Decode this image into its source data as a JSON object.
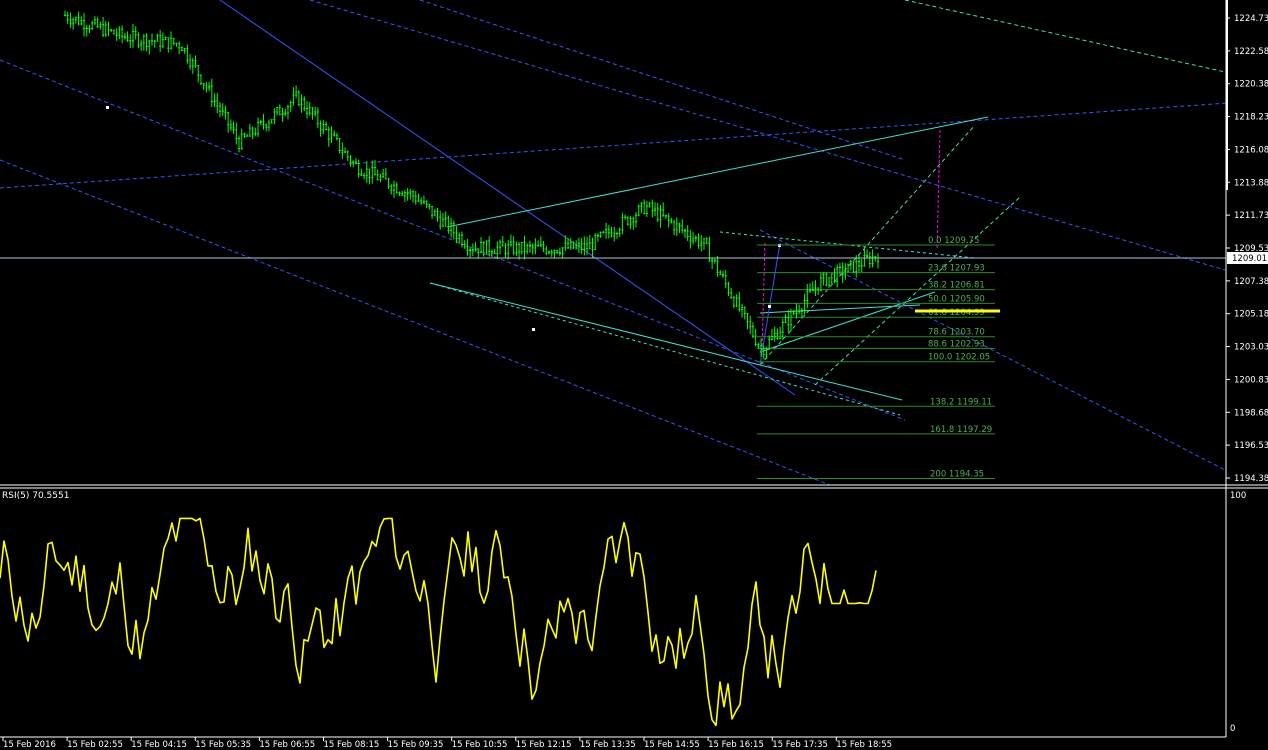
{
  "colors": {
    "background": "#000000",
    "grid_border": "#ffffff",
    "candle": "#00ff00",
    "rsi_line": "#ffff00",
    "trend_cyan": "#40e0d0",
    "trend_blue": "#3355ff",
    "fib": "#2e8b22",
    "magenta": "#ff00ff",
    "current_price_line": "#b0c4de",
    "highlight_yellow": "#ffff00"
  },
  "price_axis": {
    "ticks": [
      "1224.73",
      "1222.58",
      "1220.38",
      "1218.23",
      "1216.08",
      "1213.88",
      "1211.73",
      "1209.53",
      "1207.38",
      "1205.18",
      "1203.03",
      "1200.83",
      "1198.68",
      "1196.53",
      "1194.38"
    ],
    "current_price": "1209.01"
  },
  "time_axis": {
    "ticks": [
      "15 Feb 2016",
      "15 Feb 02:55",
      "15 Feb 04:15",
      "15 Feb 05:35",
      "15 Feb 06:55",
      "15 Feb 08:15",
      "15 Feb 09:35",
      "15 Feb 10:55",
      "15 Feb 12:15",
      "15 Feb 13:35",
      "15 Feb 14:55",
      "15 Feb 16:15",
      "15 Feb 17:35",
      "15 Feb 18:55"
    ]
  },
  "rsi": {
    "title": "RSI(5) 70.5551",
    "axis_top": "100",
    "axis_bottom": "0"
  },
  "fib_levels": [
    {
      "label": "0.0  1209.75"
    },
    {
      "label": "23.6  1207.93"
    },
    {
      "label": "38.2  1206.81"
    },
    {
      "label": "50.0  1205.90"
    },
    {
      "label": "61.8  1204.99"
    },
    {
      "label": "78.6  1203.70"
    },
    {
      "label": "88.6  1202.93"
    },
    {
      "label": "100.0  1202.05"
    },
    {
      "label": "138.2  1199.11"
    },
    {
      "label": "161.8  1197.29"
    },
    {
      "label": "200  1194.35"
    }
  ],
  "chart_data": {
    "type": "line",
    "series": [
      {
        "x": [
          "15 Feb 2016",
          "15 Feb 02:55",
          "15 Feb 04:15",
          "15 Feb 05:35",
          "15 Feb 06:55",
          "15 Feb 08:15",
          "15 Feb 09:35",
          "15 Feb 10:55",
          "15 Feb 12:15",
          "15 Feb 13:35",
          "15 Feb 14:55",
          "15 Feb 16:15",
          "15 Feb 17:35",
          "15 Feb 18:55",
          "end"
        ],
        "values": [
          1224.9,
          1223.5,
          1223.0,
          1216.5,
          1219.5,
          1215.0,
          1213.0,
          1209.6,
          1209.5,
          1209.6,
          1212.3,
          1209.8,
          1202.8,
          1207.3,
          1209.1
        ]
      }
    ],
    "price_range": [
      1193.8,
      1225.9
    ],
    "rsi_range": [
      0,
      100
    ]
  }
}
